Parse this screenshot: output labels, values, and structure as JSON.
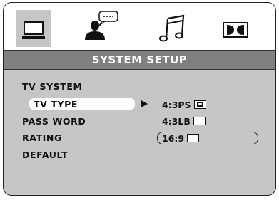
{
  "menu": {
    "title": "SYSTEM SETUP",
    "items": [
      {
        "label": "TV SYSTEM"
      },
      {
        "label": "TV TYPE"
      },
      {
        "label": "PASS WORD"
      },
      {
        "label": "RATING"
      },
      {
        "label": "DEFAULT"
      }
    ],
    "selected_item": "TV TYPE"
  },
  "options": {
    "values": [
      "4:3PS",
      "4:3LB",
      "16:9"
    ],
    "highlighted": "16:9"
  },
  "tabs": [
    {
      "name": "system-setup",
      "icon": "tv-monitor-icon",
      "active": true
    },
    {
      "name": "language-setup",
      "icon": "speech-person-icon",
      "active": false
    },
    {
      "name": "audio-setup",
      "icon": "music-note-icon",
      "active": false
    },
    {
      "name": "dolby-setup",
      "icon": "dolby-icon",
      "active": false
    }
  ]
}
